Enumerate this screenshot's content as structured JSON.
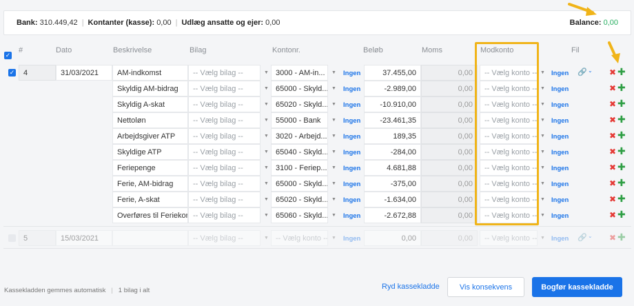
{
  "summary": {
    "bank_label": "Bank:",
    "bank_value": "310.449,42",
    "cash_label": "Kontanter (kasse):",
    "cash_value": "0,00",
    "expenses_label": "Udlæg ansatte og ejer:",
    "expenses_value": "0,00",
    "balance_label": "Balance:",
    "balance_value": "0,00"
  },
  "headers": {
    "num": "#",
    "date": "Dato",
    "description": "Beskrivelse",
    "voucher": "Bilag",
    "account": "Kontonr.",
    "amount": "Beløb",
    "vat": "Moms",
    "counter": "Modkonto",
    "file": "Fil"
  },
  "placeholders": {
    "voucher": "-- Vælg bilag --",
    "counter": "-- Vælg konto --",
    "none": "Ingen"
  },
  "main_row": {
    "num": "4",
    "date": "31/03/2021"
  },
  "rows": [
    {
      "description": "AM-indkomst",
      "account": "3000 - AM-in...",
      "amount": "37.455,00",
      "vat": "0,00"
    },
    {
      "description": "Skyldig AM-bidrag",
      "account": "65000 - Skyld...",
      "amount": "-2.989,00",
      "vat": "0,00"
    },
    {
      "description": "Skyldig A-skat",
      "account": "65020 - Skyld...",
      "amount": "-10.910,00",
      "vat": "0,00"
    },
    {
      "description": "Nettoløn",
      "account": "55000 - Bank",
      "amount": "-23.461,35",
      "vat": "0,00"
    },
    {
      "description": "Arbejdsgiver ATP",
      "account": "3020 - Arbejd...",
      "amount": "189,35",
      "vat": "0,00"
    },
    {
      "description": "Skyldige ATP",
      "account": "65040 - Skyld...",
      "amount": "-284,00",
      "vat": "0,00"
    },
    {
      "description": "Feriepenge",
      "account": "3100 - Feriep...",
      "amount": "4.681,88",
      "vat": "0,00"
    },
    {
      "description": "Ferie, AM-bidrag",
      "account": "65000 - Skyld...",
      "amount": "-375,00",
      "vat": "0,00"
    },
    {
      "description": "Ferie, A-skat",
      "account": "65020 - Skyld...",
      "amount": "-1.634,00",
      "vat": "0,00"
    },
    {
      "description": "Overføres til Feriekonto",
      "account": "65060 - Skyld...",
      "amount": "-2.672,88",
      "vat": "0,00"
    }
  ],
  "empty_row": {
    "num": "5",
    "date": "15/03/2021",
    "account": "-- Vælg konto --",
    "amount": "0,00",
    "vat": "0,00"
  },
  "footer": {
    "autosave": "Kassekladden gemmes automatisk",
    "count": "1 bilag i alt",
    "clear": "Ryd kassekladde",
    "show_vat": "Vis konsekvens",
    "post": "Bogfør kassekladde"
  },
  "colors": {
    "accent": "#1a73e8",
    "balance": "#27ae60",
    "highlight": "#f0b419",
    "delete": "#e53935",
    "add": "#2e9e44"
  }
}
